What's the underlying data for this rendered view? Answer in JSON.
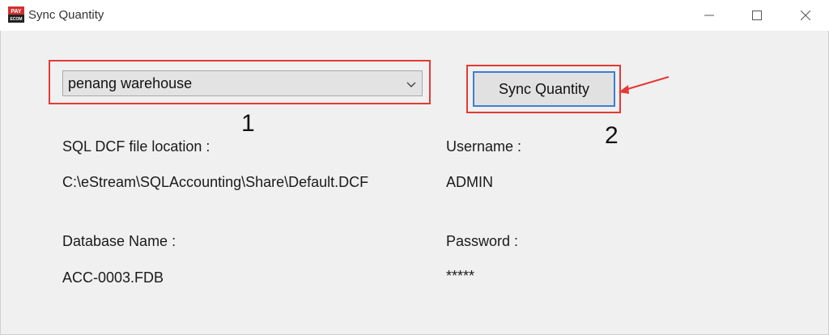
{
  "window": {
    "title": "Sync Quantity",
    "app_icon_text_top": "PAY",
    "app_icon_text_bottom": "ECOM"
  },
  "dropdown": {
    "selected_value": "penang warehouse"
  },
  "sync_button": {
    "label": "Sync Quantity"
  },
  "annotations": {
    "step1": "1",
    "step2": "2"
  },
  "fields": {
    "sql_dcf_label": "SQL DCF file location :",
    "sql_dcf_value": "C:\\eStream\\SQLAccounting\\Share\\Default.DCF",
    "database_label": "Database Name :",
    "database_value": "ACC-0003.FDB",
    "username_label": "Username :",
    "username_value": "ADMIN",
    "password_label": "Password :",
    "password_value": "*****"
  },
  "colors": {
    "highlight": "#e53935",
    "button_focus": "#3a7fd5",
    "background": "#f0f0f0"
  }
}
